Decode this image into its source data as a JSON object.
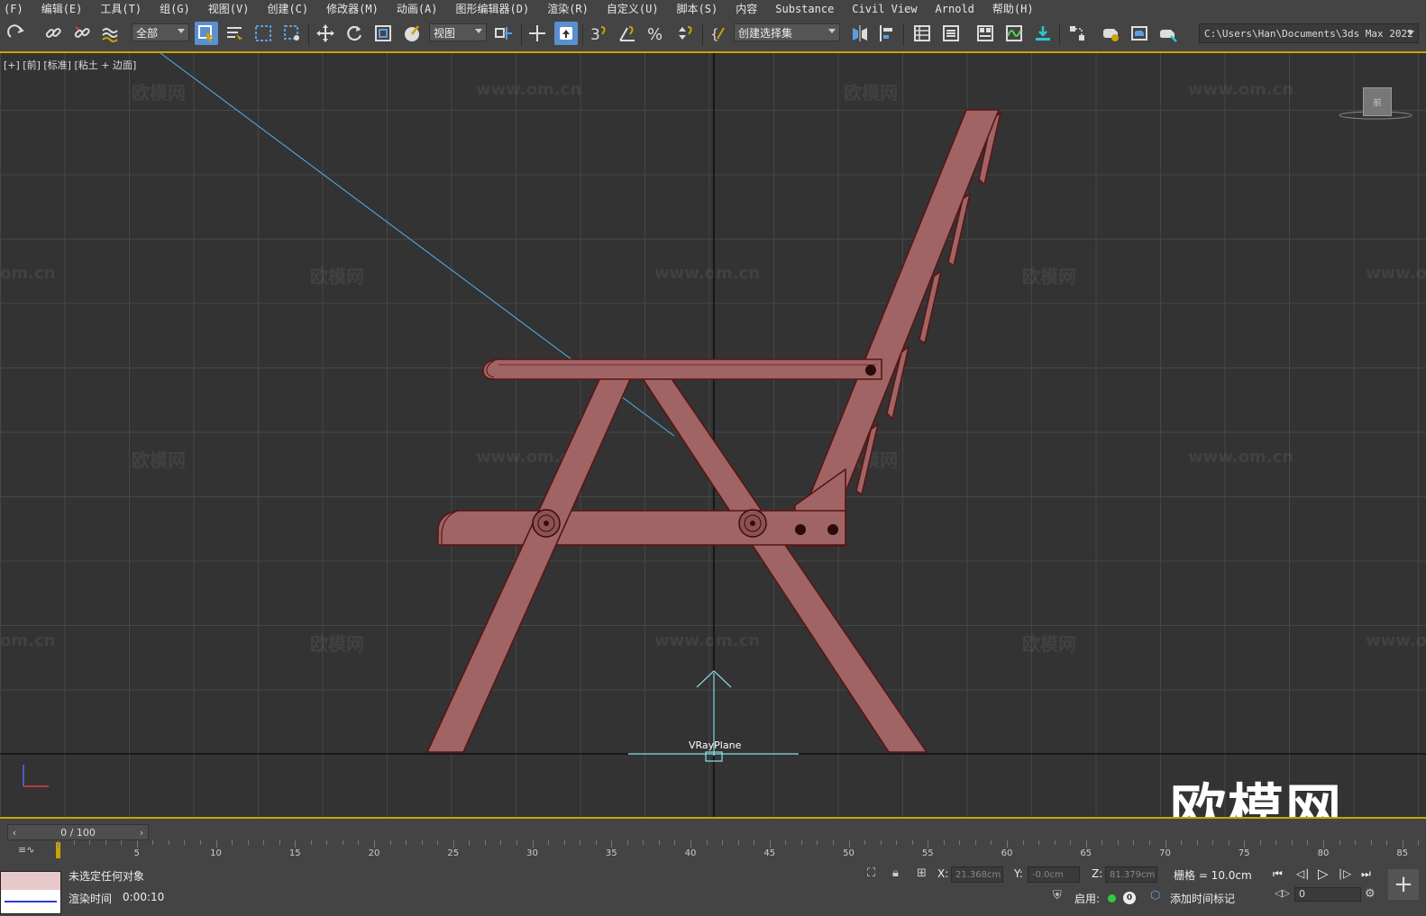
{
  "menu": [
    "(F)",
    "编辑(E)",
    "工具(T)",
    "组(G)",
    "视图(V)",
    "创建(C)",
    "修改器(M)",
    "动画(A)",
    "图形编辑器(D)",
    "渲染(R)",
    "自定义(U)",
    "脚本(S)",
    "内容",
    "Substance",
    "Civil View",
    "Arnold",
    "帮助(H)"
  ],
  "toolbar": {
    "filter_value": "全部",
    "refcoord_value": "视图",
    "selection_set_value": "创建选择集",
    "project_path": "C:\\Users\\Han\\Documents\\3ds Max 2022"
  },
  "viewport": {
    "label": "[+] [前] [标准] [粘土 + 边面]",
    "object_label": "VRayPlane",
    "watermark_site": "www.om.cn",
    "watermark_brand": "欧模网",
    "watermark_partial": "om.cn",
    "watermark_partial_left": "www.o",
    "brand_logo": "欧模网",
    "viewcube_text": "前"
  },
  "timeline": {
    "frame_counter": "0 / 100",
    "ticks": [
      "5",
      "10",
      "15",
      "20",
      "25",
      "30",
      "35",
      "40",
      "45",
      "50",
      "55",
      "60",
      "65",
      "70",
      "75",
      "80",
      "85"
    ]
  },
  "status": {
    "selection": "未选定任何对象",
    "render_time_label": "渲染时间",
    "render_time_value": "0:00:10",
    "x_label": "X:",
    "x_value": "21.368cm",
    "y_label": "Y:",
    "y_value": "-0.0cm",
    "z_label": "Z:",
    "z_value": "81.379cm",
    "grid": "栅格 = 10.0cm",
    "enable_label": "启用:",
    "enable_count": "0",
    "add_time_tag": "添加时间标记",
    "frame_value": "0"
  },
  "colors": {
    "chair_fill": "#a06464",
    "chair_edge": "#5a1414",
    "accent": "#c8a400",
    "active_tool": "#5a8fd0"
  }
}
